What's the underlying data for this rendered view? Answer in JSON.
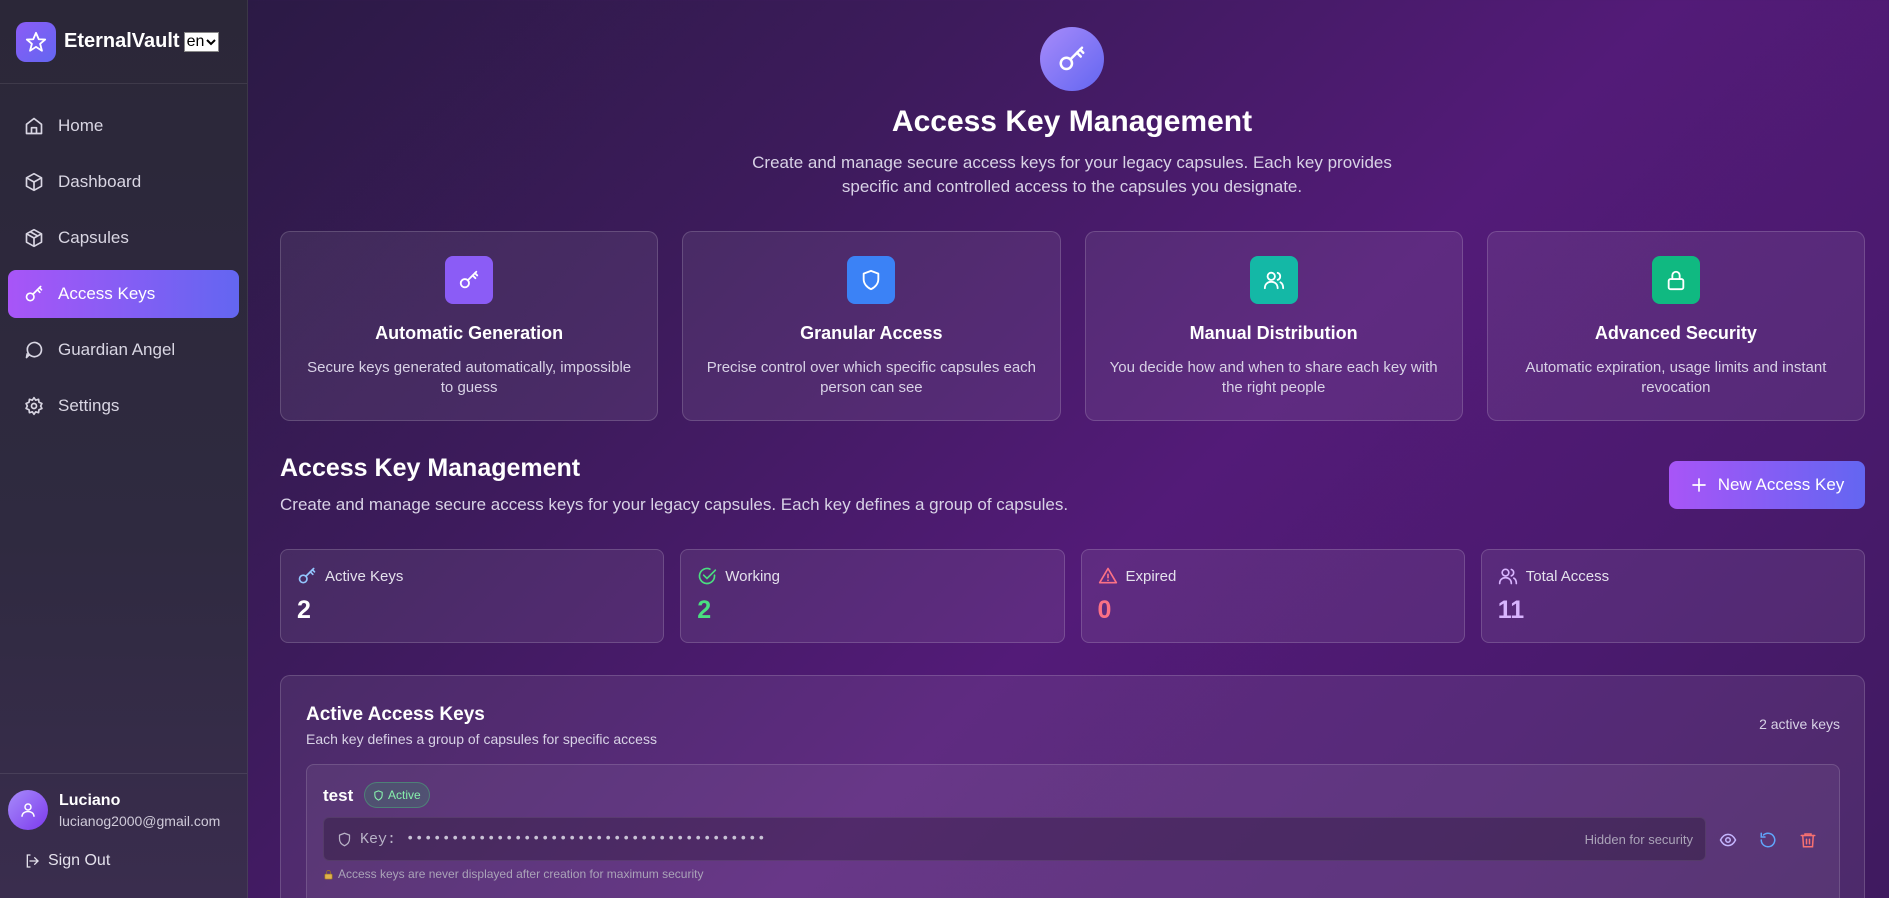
{
  "brand": {
    "name": "EternalVault",
    "language": "en"
  },
  "nav": {
    "items": [
      {
        "label": "Home",
        "icon": "home-icon"
      },
      {
        "label": "Dashboard",
        "icon": "box-icon"
      },
      {
        "label": "Capsules",
        "icon": "package-icon"
      },
      {
        "label": "Access Keys",
        "icon": "key-icon",
        "active": true
      },
      {
        "label": "Guardian Angel",
        "icon": "message-circle-icon"
      },
      {
        "label": "Settings",
        "icon": "gear-icon"
      }
    ]
  },
  "user": {
    "name": "Luciano",
    "email": "lucianog2000@gmail.com",
    "sign_out": "Sign Out"
  },
  "hero": {
    "title": "Access Key Management",
    "subtitle": "Create and manage secure access keys for your legacy capsules. Each key provides specific and controlled access to the capsules you designate."
  },
  "features": [
    {
      "title": "Automatic Generation",
      "desc": "Secure keys generated automatically, impossible to guess",
      "icon": "key-icon",
      "color": "#8b5cf6"
    },
    {
      "title": "Granular Access",
      "desc": "Precise control over which specific capsules each person can see",
      "icon": "shield-icon",
      "color": "#3b82f6"
    },
    {
      "title": "Manual Distribution",
      "desc": "You decide how and when to share each key with the right people",
      "icon": "users-icon",
      "color": "#14b8a6"
    },
    {
      "title": "Advanced Security",
      "desc": "Automatic expiration, usage limits and instant revocation",
      "icon": "lock-icon",
      "color": "#10b981"
    }
  ],
  "section": {
    "title": "Access Key Management",
    "subtitle": "Create and manage secure access keys for your legacy capsules. Each key defines a group of capsules.",
    "new_button": "New Access Key"
  },
  "stats": [
    {
      "label": "Active Keys",
      "value": "2",
      "icon": "key-icon",
      "color": "#93c5fd"
    },
    {
      "label": "Working",
      "value": "2",
      "icon": "check-circle-icon",
      "color": "#4ade80"
    },
    {
      "label": "Expired",
      "value": "0",
      "icon": "alert-triangle-icon",
      "color": "#fb7185"
    },
    {
      "label": "Total Access",
      "value": "11",
      "icon": "users-icon",
      "color": "#d8b4fe"
    }
  ],
  "keys_panel": {
    "title": "Active Access Keys",
    "subtitle": "Each key defines a group of capsules for specific access",
    "count_label": "2 active keys",
    "key": {
      "name": "test",
      "status": "Active",
      "key_label": "Key:",
      "key_masked": "••••••••••••••••••••••••••••••••••••••••",
      "hidden_label": "Hidden for security",
      "note": "Access keys are never displayed after creation for maximum security"
    }
  }
}
